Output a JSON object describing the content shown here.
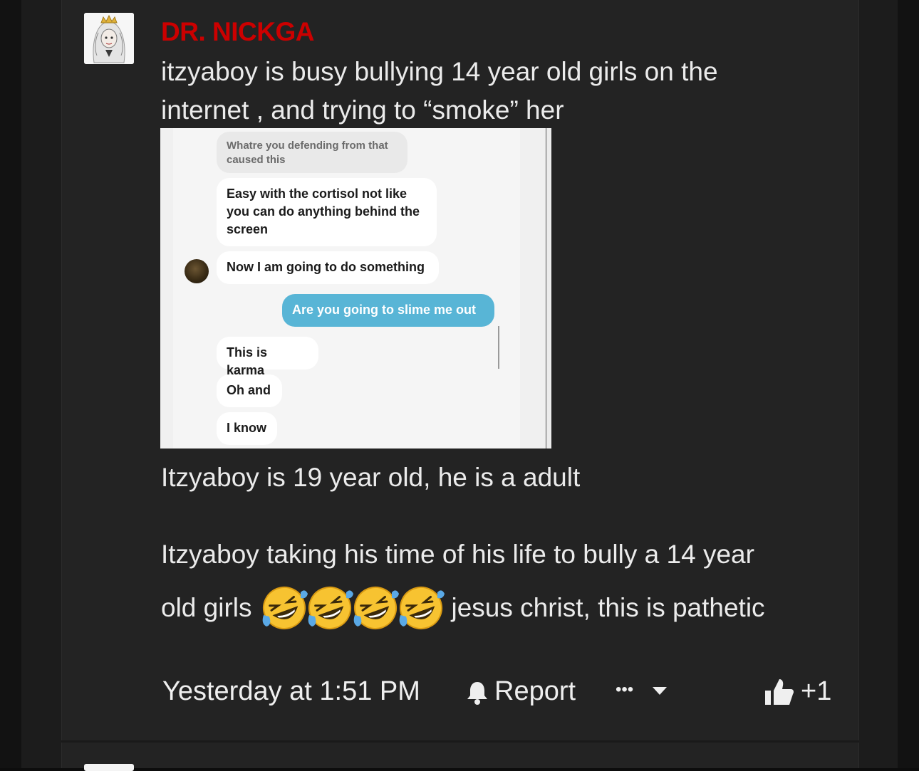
{
  "post": {
    "username": "DR. NICKGA",
    "text_line1": "itzyaboy is busy bullying 14 year old girls on the",
    "text_line2": "internet , and trying to “smoke” her",
    "text_line3": "Itzyaboy is 19 year old, he is a adult",
    "text_line4": "Itzyaboy taking his time of his life to bully a 14 year",
    "text_line5_before": "old girls",
    "emoji_count": 4,
    "emoji_name": "rolling-on-floor-laughing-emoji",
    "text_line5_after": "jesus christ, this is pathetic"
  },
  "screenshot": {
    "messages": [
      {
        "sender": "other",
        "text_a": "Whatre you defending from that",
        "text_b": "caused this"
      },
      {
        "sender": "other",
        "text_a": "Easy with the cortisol not like",
        "text_b": "you can do anything behind the",
        "text_c": "screen"
      },
      {
        "sender": "other",
        "text": "Now I am going to do something"
      },
      {
        "sender": "me",
        "text": "Are you going to slime me out"
      },
      {
        "sender": "other",
        "text": "This is karma"
      },
      {
        "sender": "other",
        "text": "Oh and"
      },
      {
        "sender": "other",
        "text": "I know"
      }
    ]
  },
  "footer": {
    "timestamp": "Yesterday at 1:51 PM",
    "report_label": "Report",
    "more_label": "•••",
    "like_count": "+1"
  },
  "colors": {
    "username": "#cc0000",
    "background": "#232323",
    "text": "#ebebeb",
    "sent_bubble": "#58b5d6"
  }
}
